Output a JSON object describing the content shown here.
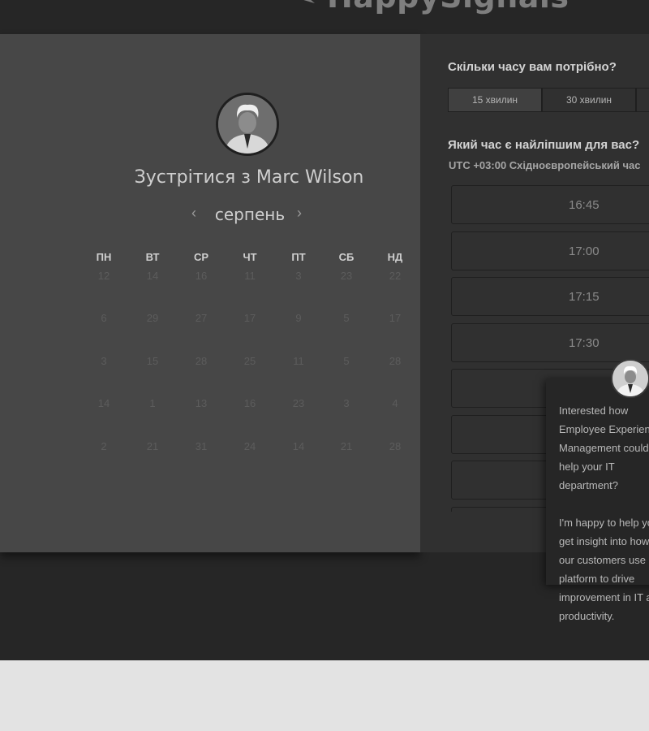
{
  "brand": {
    "name": "HappySignals"
  },
  "calendar": {
    "title": "Зустрітися з Marc Wilson",
    "month": "серпень",
    "prev_icon": "‹",
    "next_icon": "›",
    "weekdays": [
      "ПН",
      "ВТ",
      "СР",
      "ЧТ",
      "ПТ",
      "СБ",
      "НД"
    ],
    "weeks": [
      [
        "12",
        "14",
        "16",
        "11",
        "3",
        "23",
        "22"
      ],
      [
        "6",
        "29",
        "27",
        "17",
        "9",
        "5",
        "17"
      ],
      [
        "3",
        "15",
        "28",
        "25",
        "11",
        "5",
        "28"
      ],
      [
        "14",
        "1",
        "13",
        "16",
        "23",
        "3",
        "4"
      ],
      [
        "2",
        "21",
        "31",
        "24",
        "14",
        "21",
        "28"
      ]
    ]
  },
  "booking": {
    "duration_question": "Скільки часу вам потрібно?",
    "durations": [
      "15 хвилин",
      "30 хвилин",
      ""
    ],
    "selected_duration": "15 хвилин",
    "time_question": "Який час є найліпшим для вас?",
    "timezone": "UTC +03:00 Східноєвропейський час",
    "time_slots": [
      "16:45",
      "17:00",
      "17:15",
      "17:30",
      "",
      "",
      ""
    ]
  },
  "chat": {
    "message": "Interested how Employee Experience Management could help your IT department?\n\nI'm happy to help you get insight into how our customers use our platform to drive improvement in IT and productivity."
  },
  "colors": {
    "page_background": "#262626",
    "calendar_panel": "#474747",
    "booking_panel": "#303030",
    "footer": "#e3e3e3"
  }
}
